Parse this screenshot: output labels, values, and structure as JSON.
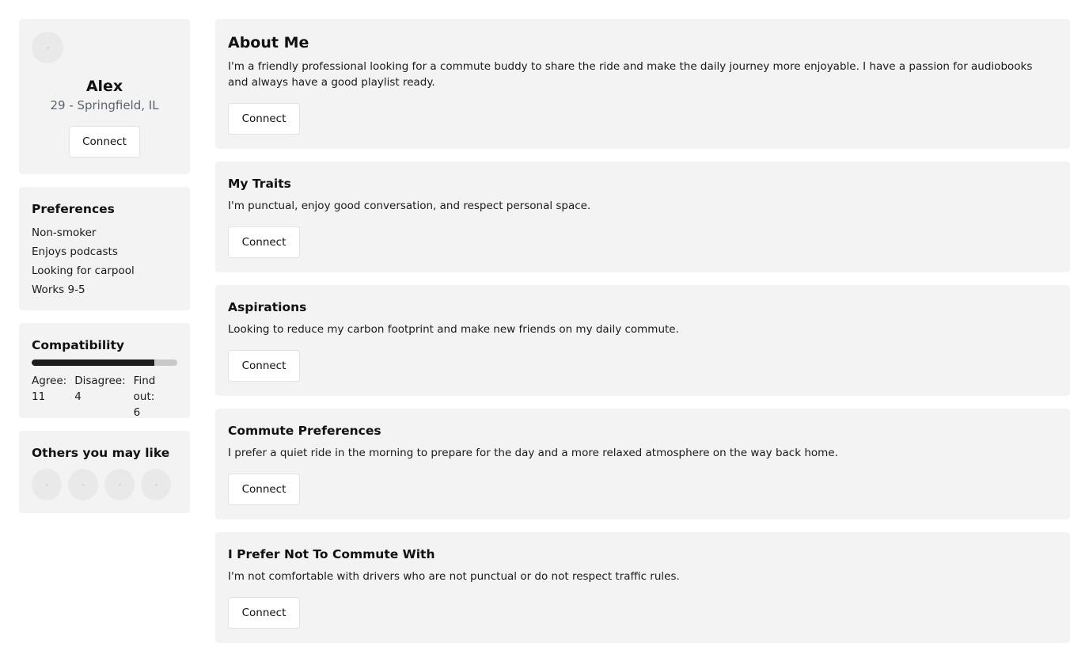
{
  "profile": {
    "name": "Alex",
    "subtitle": "29 - Springfield, IL",
    "connect_label": "Connect"
  },
  "preferences": {
    "title": "Preferences",
    "items": [
      {
        "label": "Non-smoker"
      },
      {
        "label": "Enjoys podcasts"
      },
      {
        "label": "Looking for carpool"
      },
      {
        "label": "Works 9-5"
      }
    ]
  },
  "compatibility": {
    "title": "Compatibility",
    "progress_fraction": 0.84,
    "agree_label": "Agree:",
    "agree_value": "11",
    "disagree_label": "Disagree:",
    "disagree_value": "4",
    "findout_label": "Find out:",
    "findout_value": "6"
  },
  "others": {
    "title": "Others you may like"
  },
  "sections": [
    {
      "title": "About Me",
      "text": "I'm a friendly professional looking for a commute buddy to share the ride and make the daily journey more enjoyable. I have a passion for audiobooks and always have a good playlist ready.",
      "button": "Connect"
    },
    {
      "title": "My Traits",
      "text": "I'm punctual, enjoy good conversation, and respect personal space.",
      "button": "Connect"
    },
    {
      "title": "Aspirations",
      "text": "Looking to reduce my carbon footprint and make new friends on my daily commute.",
      "button": "Connect"
    },
    {
      "title": "Commute Preferences",
      "text": "I prefer a quiet ride in the morning to prepare for the day and a more relaxed atmosphere on the way back home.",
      "button": "Connect"
    },
    {
      "title": "I Prefer Not To Commute With",
      "text": "I'm not comfortable with drivers who are not punctual or do not respect traffic rules.",
      "button": "Connect"
    }
  ]
}
